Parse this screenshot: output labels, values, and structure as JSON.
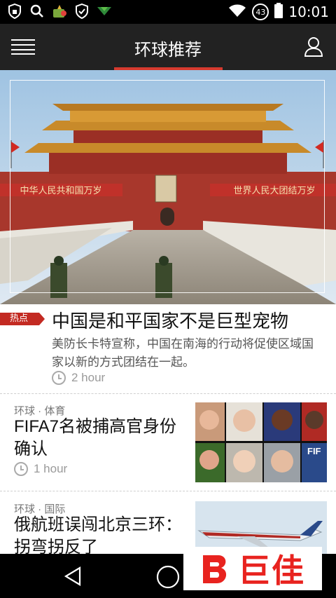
{
  "status_bar": {
    "time": "10:01",
    "notification_count": "43"
  },
  "app_bar": {
    "title": "环球推荐"
  },
  "featured": {
    "hero_banner_left": "中华人民共和国万岁",
    "hero_banner_right": "世界人民大团结万岁",
    "tag": "热点",
    "headline": "中国是和平国家不是巨型宠物",
    "summary": "美防长卡特宣称，中国在南海的行动将促使区域国家以新的方式团结在一起。",
    "time": "2 hour"
  },
  "items": [
    {
      "category": "环球 · 体育",
      "headline": "FIFA7名被捕高官身份确认",
      "time": "1 hour",
      "thumb_text": "FIF"
    },
    {
      "category": "环球 · 国际",
      "headline": "俄航班误闯北京三环：拐弯拐反了"
    }
  ],
  "watermark": "巨佳",
  "colors": {
    "accent": "#d63a2f",
    "appbar": "#222222",
    "statusbar": "#000000"
  }
}
